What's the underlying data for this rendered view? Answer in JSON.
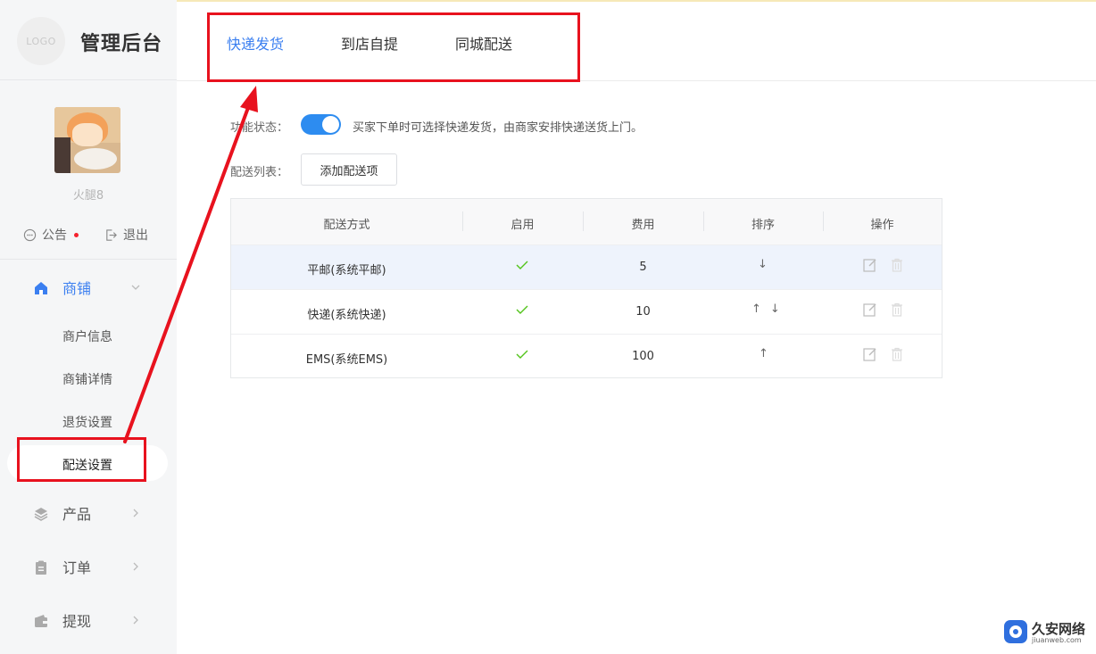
{
  "app": {
    "logo_text": "LOGO",
    "title": "管理后台"
  },
  "user": {
    "name": "火腿8"
  },
  "sidebar": {
    "notice_label": "公告",
    "logout_label": "退出",
    "menu": [
      {
        "label": "商铺",
        "icon": "home-icon",
        "expanded": true
      },
      {
        "label": "产品",
        "icon": "layers-icon",
        "expanded": false
      },
      {
        "label": "订单",
        "icon": "clipboard-icon",
        "expanded": false
      },
      {
        "label": "提现",
        "icon": "wallet-icon",
        "expanded": false
      }
    ],
    "shop_submenu": [
      "商户信息",
      "商铺详情",
      "退货设置",
      "配送设置"
    ]
  },
  "tabs": [
    "快递发货",
    "到店自提",
    "同城配送"
  ],
  "settings": {
    "status_label": "功能状态：",
    "status_desc": "买家下单时可选择快递发货，由商家安排快递送货上门。",
    "list_label": "配送列表：",
    "add_button": "添加配送项"
  },
  "table": {
    "columns": [
      "配送方式",
      "启用",
      "费用",
      "排序",
      "操作"
    ],
    "rows": [
      {
        "method": "平邮(系统平邮)",
        "enabled": true,
        "fee": "5",
        "sort": [
          "↓"
        ]
      },
      {
        "method": "快递(系统快递)",
        "enabled": true,
        "fee": "10",
        "sort": [
          "↑",
          "↓"
        ]
      },
      {
        "method": "EMS(系统EMS)",
        "enabled": true,
        "fee": "100",
        "sort": [
          "↑"
        ]
      }
    ]
  },
  "watermark": {
    "name": "久安网络",
    "site": "jiuanweb.com"
  },
  "colors": {
    "accent": "#3b7ff0",
    "switch": "#2d8cf0",
    "annotation": "#e8121e",
    "check": "#52c41a"
  }
}
